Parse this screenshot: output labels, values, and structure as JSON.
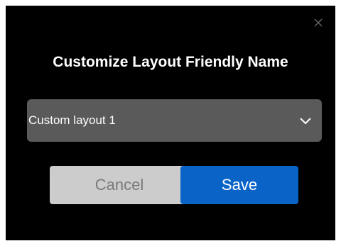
{
  "dialog": {
    "title": "Customize Layout Friendly Name",
    "close_icon": "close-icon",
    "layout_select": {
      "selected_value": "Custom layout 1",
      "icon": "chevron-down-icon"
    },
    "buttons": {
      "cancel_label": "Cancel",
      "save_label": "Save"
    }
  },
  "colors": {
    "dialog_background": "#000000",
    "select_background": "#5a5a5a",
    "cancel_background": "#cccccc",
    "cancel_text": "#7a7a7a",
    "save_background": "#0a64c8",
    "save_text": "#ffffff"
  }
}
